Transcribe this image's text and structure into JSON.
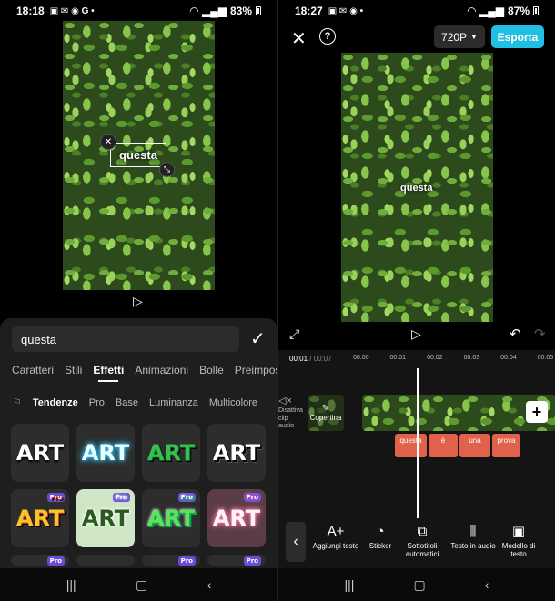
{
  "left": {
    "status": {
      "time": "18:18",
      "battery": "83%"
    },
    "video_caption": "questa",
    "sheet": {
      "input_value": "questa",
      "tabs": [
        "Caratteri",
        "Stili",
        "Effetti",
        "Animazioni",
        "Bolle",
        "Preimposta"
      ],
      "active_tab": "Effetti",
      "subtabs": [
        "Tendenze",
        "Pro",
        "Base",
        "Luminanza",
        "Multicolore"
      ],
      "active_subtab": "Tendenze",
      "pro_label": "Pro",
      "art_label": "ART"
    }
  },
  "right": {
    "status": {
      "time": "18:27",
      "battery": "87%"
    },
    "resolution": "720P",
    "export_label": "Esporta",
    "video_caption": "questa",
    "timeline": {
      "current": "00:01",
      "total": "00:07",
      "ruler": [
        "00:00",
        "00:01",
        "00:02",
        "00:03",
        "00:04",
        "00:05"
      ],
      "mute_label": "Disattiva clip audio",
      "cover_label": "Copertina",
      "text_clips": [
        "questa",
        "è",
        "una",
        "prova"
      ]
    },
    "tools": [
      {
        "icon": "A+",
        "label": "Aggiungi testo"
      },
      {
        "icon": "◔",
        "label": "Sticker"
      },
      {
        "icon": "⧉",
        "label": "Sottotitoli automatici"
      },
      {
        "icon": "⫼",
        "label": "Testo in audio"
      },
      {
        "icon": "▣",
        "label": "Modello di testo"
      }
    ]
  },
  "colors": {
    "export": "#21bfe1",
    "text_clip": "#e0624a",
    "pro_badge": "#6b4cd6"
  }
}
